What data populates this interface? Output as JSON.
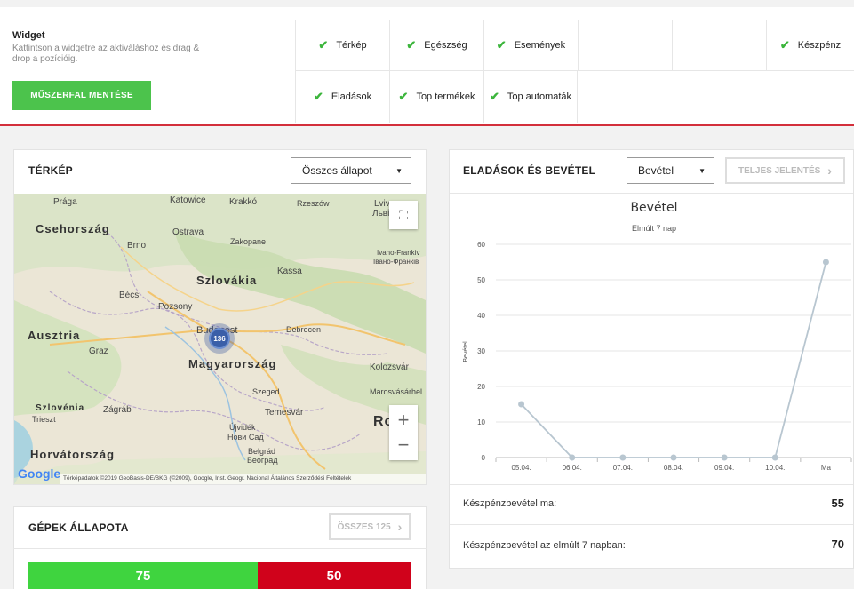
{
  "widget": {
    "title": "Widget",
    "hint": "Kattintson a widgetre az aktiváláshoz és drag & drop a pozícióig.",
    "save_label": "MŰSZERFAL MENTÉSE",
    "row1": [
      "Térkép",
      "Egészség",
      "Események",
      "",
      "",
      "Készpénz"
    ],
    "row2": [
      "Eladások",
      "Top termékek",
      "Top automaták"
    ],
    "check_color": "#3cb53c"
  },
  "map_panel": {
    "title": "TÉRKÉP",
    "filter_value": "Összes állapot",
    "cluster_count": "136",
    "places": [
      "Prága",
      "Katowice",
      "Krakkó",
      "Rzeszów",
      "Lviv",
      "Львів",
      "Brno",
      "Ostrava",
      "Zakopane",
      "Ivano-Frankiv",
      "Івано-Франків",
      "Bécs",
      "Pozsony",
      "Kassa",
      "Budapest",
      "Debrecen",
      "Graz",
      "Kolozsvár",
      "Szeged",
      "Marosvásárhel",
      "Zágráb",
      "Trieszt",
      "Temesvár",
      "Újvidék",
      "Нови Сад",
      "Belgrád",
      "Београд",
      "Ro"
    ],
    "countries": [
      "Csehország",
      "Szlovákia",
      "Ausztria",
      "Magyarország",
      "Szlovénia",
      "Horvátország"
    ],
    "attribution": "Térképadatok ©2019 GeoBasis-DE/BKG (©2009), Google, Inst. Geogr. Nacional   Általános Szerződési Feltételek",
    "google_logo": "Google",
    "zoom_in": "+",
    "zoom_out": "−"
  },
  "machines_panel": {
    "title": "GÉPEK ÁLLAPOTA",
    "all_label": "ÖSSZES 125",
    "green_value": "75",
    "red_value": "50",
    "green_count": 75,
    "red_count": 50,
    "green_color": "#3fd43f",
    "red_color": "#d0021b"
  },
  "sales_panel": {
    "title": "ELADÁSOK ÉS BEVÉTEL",
    "select_value": "Bevétel",
    "report_label": "TELJES JELENTÉS",
    "stats": [
      {
        "label": "Készpénzbevétel ma:",
        "value": "55"
      },
      {
        "label": "Készpénzbevétel az elmúlt 7 napban:",
        "value": "70"
      }
    ]
  },
  "chart_data": {
    "type": "line",
    "title": "Bevétel",
    "subtitle": "Elmúlt 7 nap",
    "ylabel": "Bevétel",
    "xlabel": "",
    "x": [
      "05.04.",
      "06.04.",
      "07.04.",
      "08.04.",
      "09.04.",
      "10.04.",
      "Ma"
    ],
    "series": [
      {
        "values": [
          15,
          0,
          0,
          0,
          0,
          0,
          55
        ]
      }
    ],
    "ylim": [
      0,
      60
    ],
    "yticks": [
      0,
      10,
      20,
      30,
      40,
      50,
      60
    ],
    "grid": true,
    "line_color": "#b8c6d0"
  }
}
